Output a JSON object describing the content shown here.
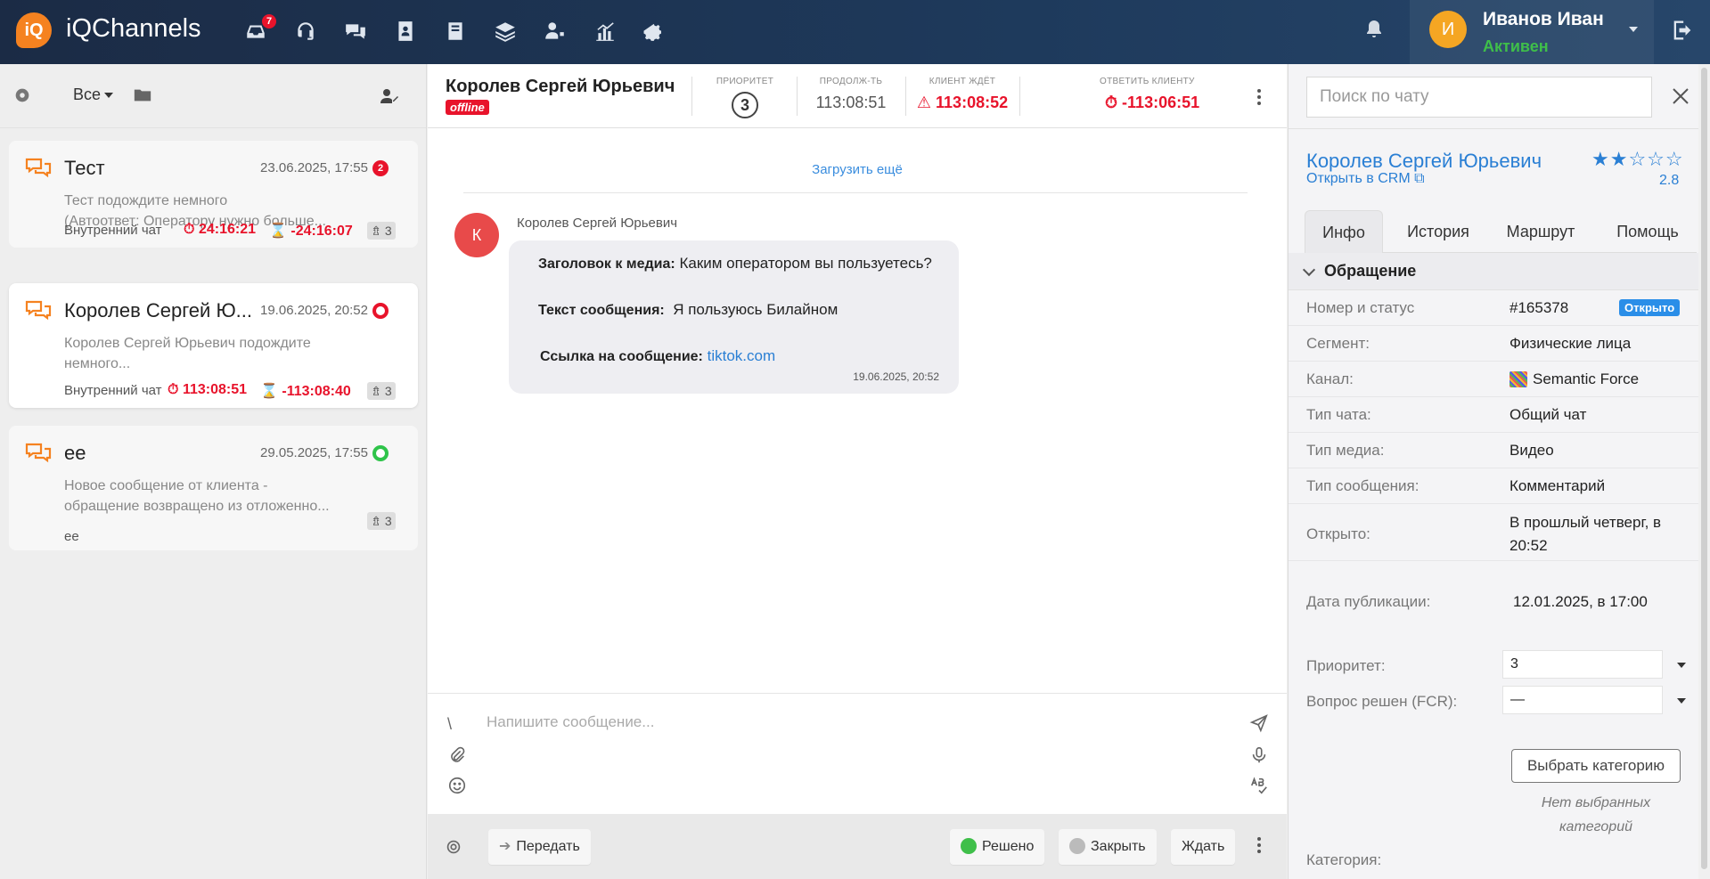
{
  "app": {
    "logo_mark": "iQ",
    "name": "iQChannels"
  },
  "nav": {
    "icons": [
      "inbox-icon",
      "headset-icon",
      "chats-icon",
      "contacts-icon",
      "book-icon",
      "layers-icon",
      "user-settings-icon",
      "analytics-icon",
      "settings-icon"
    ],
    "inbox_badge": "7"
  },
  "user": {
    "initial": "И",
    "name": "Иванов Иван",
    "status": "Активен"
  },
  "left_panel": {
    "filter": "Все",
    "conversations": [
      {
        "title": "Тест",
        "date": "23.06.2025, 17:55",
        "badge": "2",
        "preview1": "Тест подождите немного",
        "preview2": "(Автоответ: Оператору нужно больше...",
        "channel": "Внутренний чат",
        "timer1": "24:16:21",
        "timer2": "-24:16:07",
        "priority": "3"
      },
      {
        "title": "Королев Сергей Ю...",
        "date": "19.06.2025, 20:52",
        "preview1": "Королев Сергей Юрьевич подождите",
        "preview2": "немного...",
        "channel": "Внутренний чат",
        "timer1": "113:08:51",
        "timer2": "-113:08:40",
        "priority": "3"
      },
      {
        "title": "ее",
        "date": "29.05.2025, 17:55",
        "preview1": "Новое сообщение от клиента -",
        "preview2": "обращение возвращено из отложенно...",
        "channel": "ее",
        "priority": "3"
      }
    ]
  },
  "chat": {
    "client_name": "Королев Сергей Юрьевич",
    "status_tag": "offline",
    "stats": {
      "priority_label": "ПРИОРИТЕТ",
      "priority_value": "3",
      "duration_label": "ПРОДОЛЖ-ТЬ",
      "duration_value": "113:08:51",
      "waiting_label": "КЛИЕНТ ЖДЁТ",
      "waiting_value": "113:08:52",
      "reply_label": "ОТВЕТИТЬ КЛИЕНТУ",
      "reply_value": "-113:06:51"
    },
    "load_more": "Загрузить ещё",
    "message": {
      "avatar": "К",
      "author": "Королев Сергей Юрьевич",
      "media_title_label": "Заголовок к медиа:",
      "media_title": "Каким оператором вы пользуетесь?",
      "text_label": "Текст сообщения:",
      "text": "Я пользуюсь Билайном",
      "link_label": "Ссылка на сообщение:",
      "link": "tiktok.com",
      "time": "19.06.2025, 20:52"
    },
    "composer_placeholder": "Напишите сообщение...",
    "composer_slash": "\\",
    "footer": {
      "transfer": "Передать",
      "resolved": "Решено",
      "close": "Закрыть",
      "wait": "Ждать"
    }
  },
  "right_panel": {
    "search_placeholder": "Поиск по чату",
    "client_name": "Королев Сергей Юрьевич",
    "crm_link": "Открыть в CRM",
    "stars": "★★☆☆☆",
    "rating": "2.8",
    "tabs": [
      "Инфо",
      "История",
      "Маршрут",
      "Помощь"
    ],
    "section": "Обращение",
    "rows": {
      "number_label": "Номер и статус",
      "number_value": "#165378",
      "status": "Открыто",
      "segment_label": "Сегмент:",
      "segment_value": "Физические лица",
      "channel_label": "Канал:",
      "channel_value": "Semantic Force",
      "chat_type_label": "Тип чата:",
      "chat_type_value": "Общий чат",
      "media_type_label": "Тип медиа:",
      "media_type_value": "Видео",
      "msg_type_label": "Тип сообщения:",
      "msg_type_value": "Комментарий",
      "opened_label": "Открыто:",
      "opened_value1": "В прошлый четверг, в",
      "opened_value2": "20:52",
      "pub_label": "Дата публикации:",
      "pub_value": "12.01.2025, в 17:00",
      "priority_label": "Приоритет:",
      "priority_value": "3",
      "fcr_label": "Вопрос решен (FCR):",
      "fcr_value": "—",
      "category_label": "Категория:",
      "category_button": "Выбрать категорию",
      "no_category1": "Нет выбранных",
      "no_category2": "категорий"
    }
  },
  "colors": {
    "accent": "#2a7fd4",
    "danger": "#e8132b",
    "brand": "#f58220",
    "success": "#2fc44a"
  }
}
